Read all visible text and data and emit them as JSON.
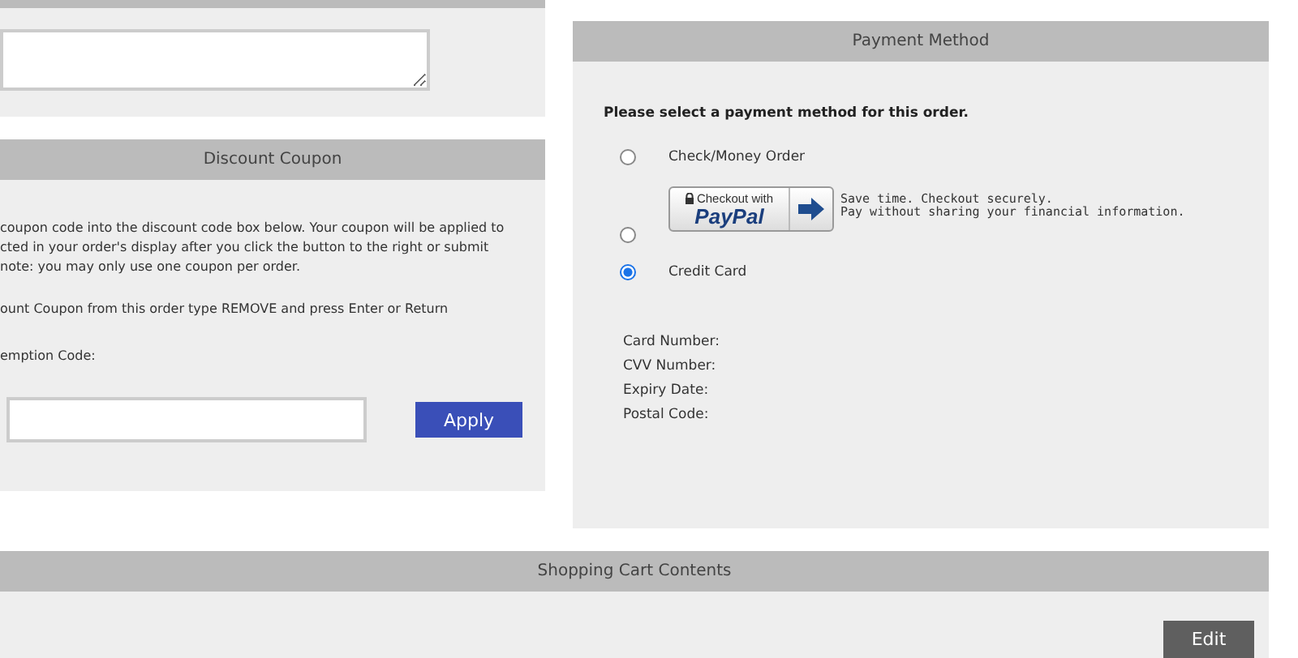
{
  "coupon": {
    "title": "Discount Coupon",
    "paragraph_lines": [
      "coupon code into the discount code box below. Your coupon will be applied to",
      "cted in your order's display after you click the button to the right or submit",
      "note: you may only use one coupon per order."
    ],
    "remove_note": "ount Coupon from this order type REMOVE and press Enter or Return",
    "code_label": "emption Code:",
    "apply_button": "Apply"
  },
  "payment": {
    "title": "Payment Method",
    "prompt": "Please select a payment method for this order.",
    "options": [
      {
        "kind": "text",
        "label": "Check/Money Order",
        "selected": false
      },
      {
        "kind": "paypal",
        "badge_top": "Checkout with",
        "badge_brand": "PayPal",
        "lines": [
          "Save time. Checkout securely.",
          "Pay without sharing your financial information."
        ],
        "selected": false
      },
      {
        "kind": "text",
        "label": "Credit Card",
        "selected": true
      }
    ],
    "card_fields": [
      "Card Number:",
      "CVV Number:",
      "Expiry Date:",
      "Postal Code:"
    ]
  },
  "cart": {
    "title": "Shopping Cart Contents",
    "edit_button": "Edit"
  }
}
